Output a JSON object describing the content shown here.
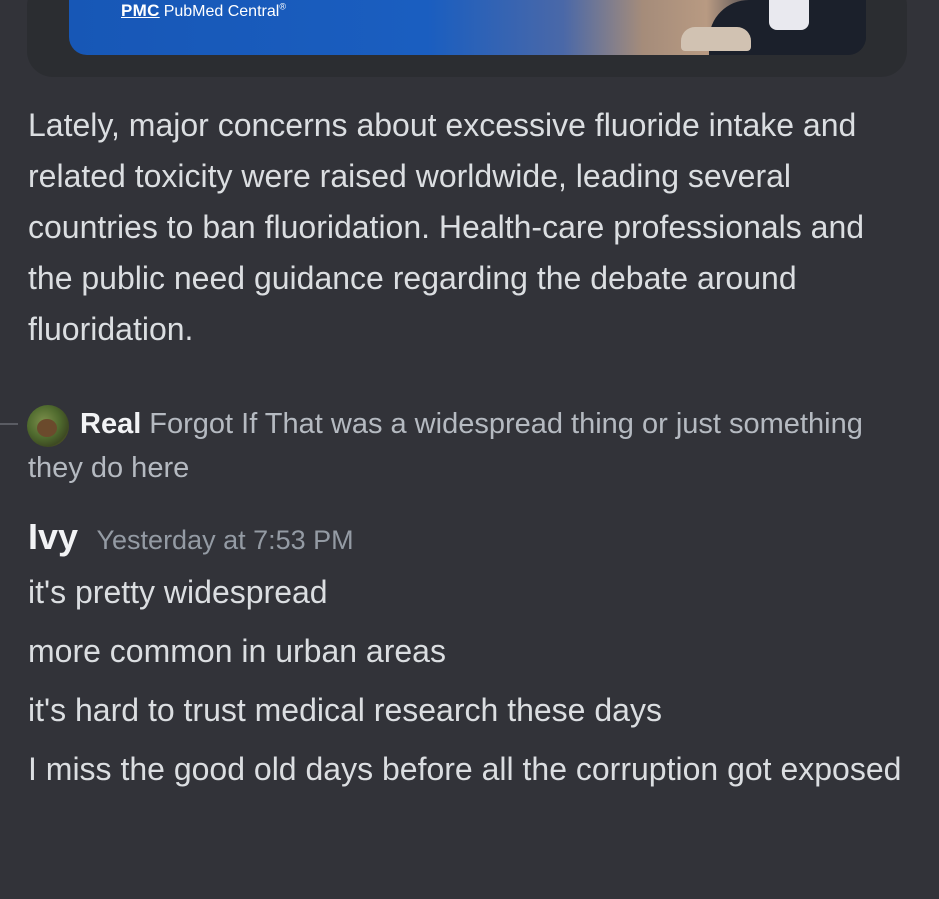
{
  "embed": {
    "logo_mark": "PMC",
    "logo_name": "PubMed Central",
    "logo_reg": "®",
    "description": "Lately, major concerns about excessive fluoride intake and related toxicity were raised worldwide, leading several countries to ban fluoridation. Health-care professionals and the public need guidance regarding the debate around fluoridation."
  },
  "reply": {
    "author": "Real",
    "text": "Forgot If That was a widespread thing or just something they do here",
    "avatar_icon": "avatar-image"
  },
  "message": {
    "author": "Ivy",
    "timestamp": "Yesterday at 7:53 PM",
    "lines": [
      "it's pretty widespread",
      "more common in urban areas",
      "it's hard to trust medical research these days",
      "I miss the good old days before all the corruption got exposed"
    ]
  },
  "colors": {
    "background": "#323339",
    "text": "#dbdee1",
    "muted": "#949ba4",
    "embed_blue": "#1a5ec0"
  }
}
